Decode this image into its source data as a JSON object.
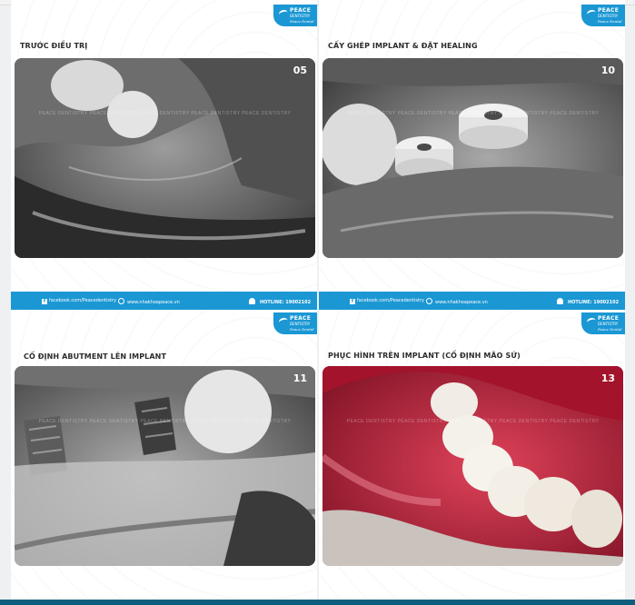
{
  "brand": {
    "name": "PEACE",
    "sub": "DENTISTRY",
    "script": "Peace Dental",
    "accent_color": "#1b97d4"
  },
  "footer": {
    "facebook": "facebook.com/Peacedentistry",
    "website": "www.nhakhoapeace.vn",
    "hotline": "HOTLINE: 19002102",
    "icons": [
      "facebook-icon",
      "globe-icon",
      "phone-icon"
    ]
  },
  "watermark": "PEACE DENTISTRY PEACE DENTISTRY PEACE DENTISTRY PEACE DENTISTRY PEACE DENTISTRY",
  "cards": [
    {
      "title": "TRƯỚC ĐIỀU TRỊ",
      "number": "05"
    },
    {
      "title": "CẤY GHÉP IMPLANT & ĐẶT HEALING",
      "number": "10"
    },
    {
      "title": "CỐ ĐỊNH ABUTMENT LÊN IMPLANT",
      "number": "11"
    },
    {
      "title": "PHỤC HÌNH TRÊN IMPLANT  (CỐ ĐỊNH MÃO SỨ)",
      "number": "13"
    }
  ]
}
